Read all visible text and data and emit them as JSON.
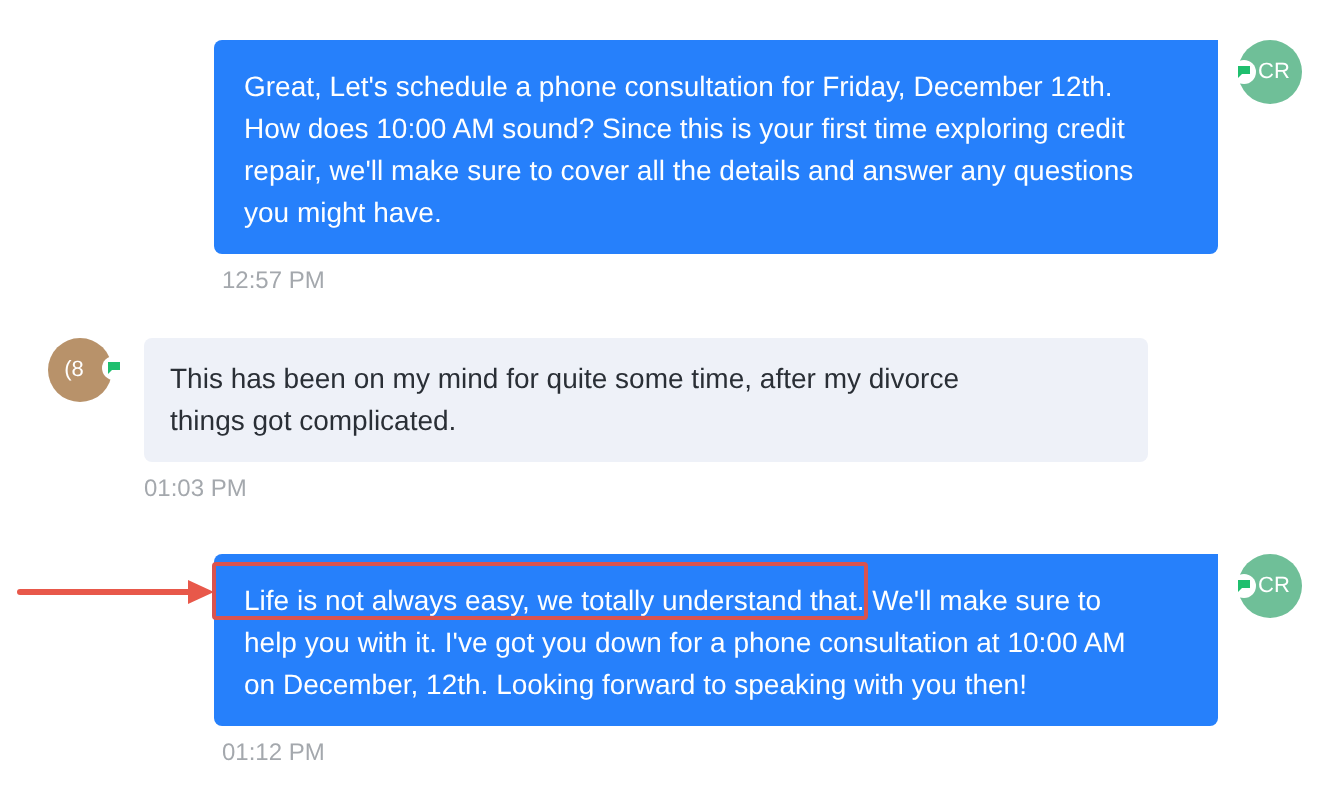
{
  "messages": [
    {
      "kind": "outgoing",
      "avatar": "CR",
      "text": "Great, Let's schedule a phone consultation for Friday, December 12th. How does 10:00 AM sound? Since this is your first time exploring credit repair, we'll make sure to cover all the details and answer any questions you might have.",
      "time": "12:57 PM",
      "highlighted": false
    },
    {
      "kind": "incoming",
      "avatar": "(8",
      "text": "This has been on my mind for quite some time, after my divorce things got complicated.",
      "time": "01:03 PM",
      "highlighted": false
    },
    {
      "kind": "outgoing",
      "avatar": "CR",
      "text": "Life is not always easy, we totally understand that. We'll make sure to help you with it. I've got you down for a phone consultation at 10:00 AM on December, 12th. Looking forward to speaking with you then!",
      "time": "01:12 PM",
      "highlighted": true
    }
  ]
}
